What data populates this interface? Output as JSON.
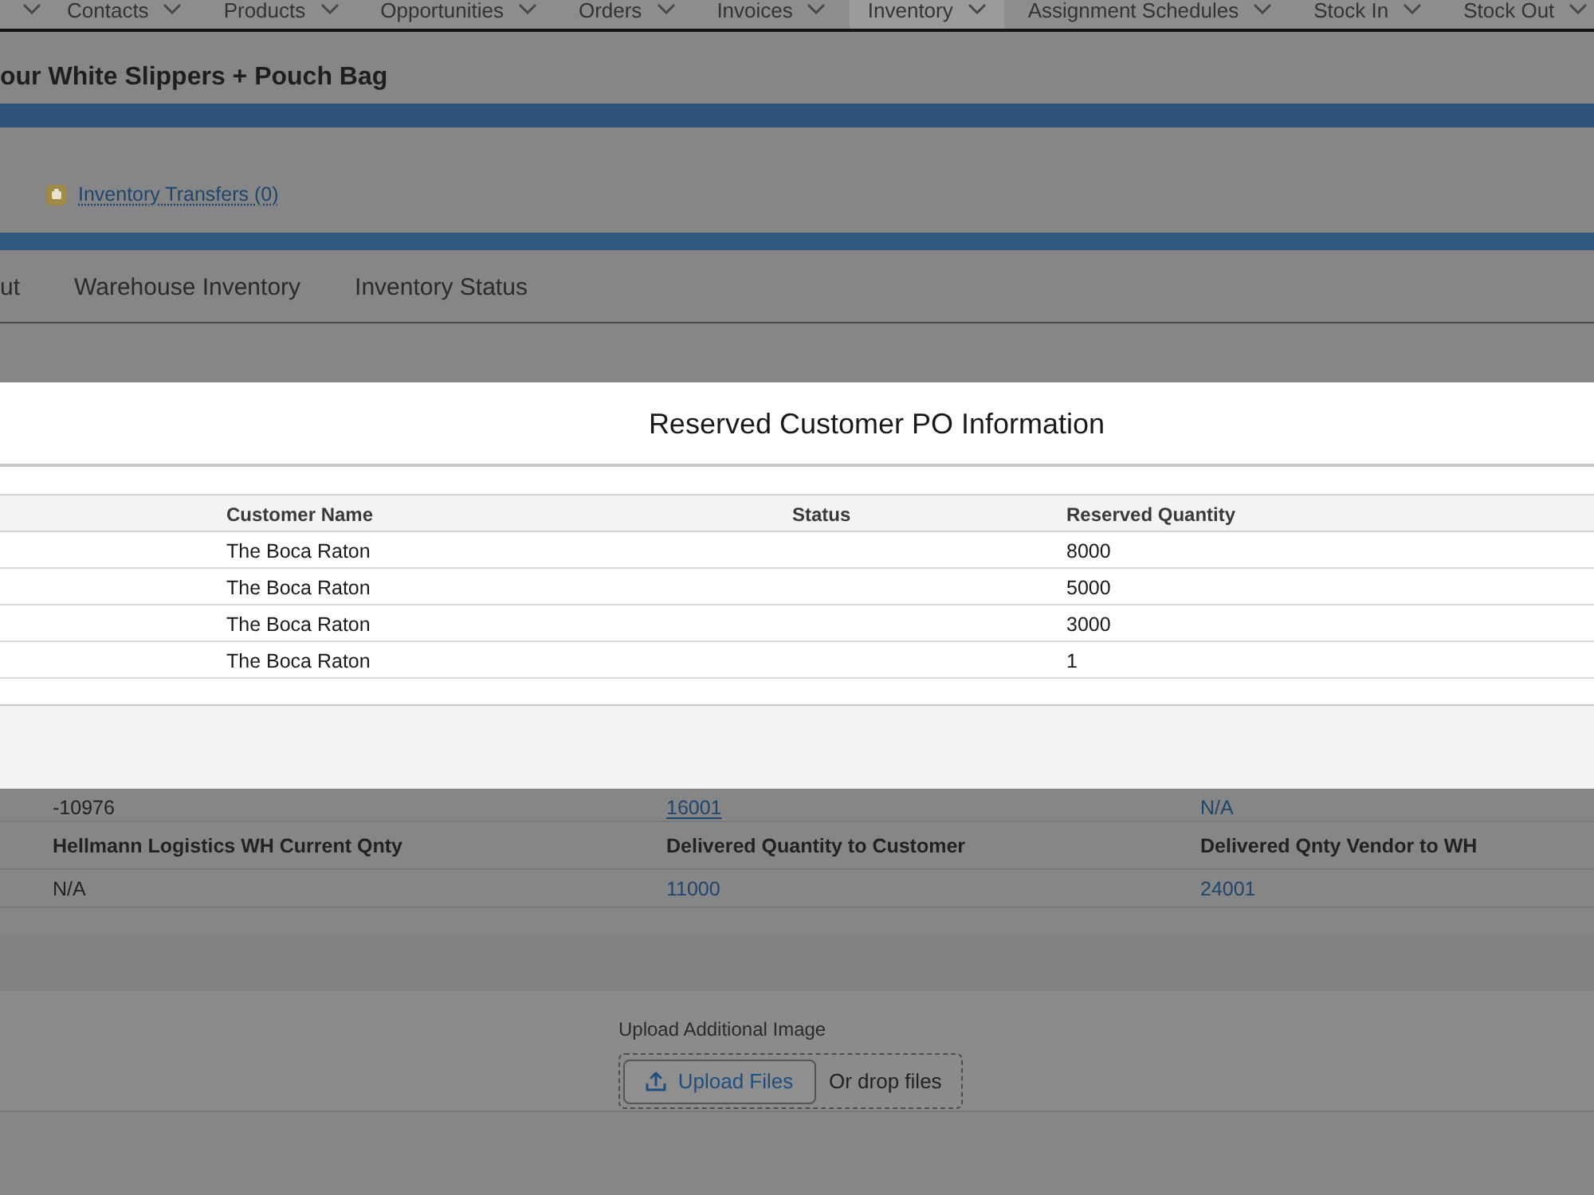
{
  "nav": {
    "items": [
      {
        "label": "Contacts",
        "selected": false
      },
      {
        "label": "Products",
        "selected": false
      },
      {
        "label": "Opportunities",
        "selected": false
      },
      {
        "label": "Orders",
        "selected": false
      },
      {
        "label": "Invoices",
        "selected": false
      },
      {
        "label": "Inventory",
        "selected": true
      },
      {
        "label": "Assignment Schedules",
        "selected": false
      },
      {
        "label": "Stock In",
        "selected": false
      },
      {
        "label": "Stock Out",
        "selected": false
      }
    ]
  },
  "record": {
    "title": "our White Slippers + Pouch Bag"
  },
  "related_lists": [
    {
      "label": "Inventory Transfers (0)"
    }
  ],
  "tabs": [
    {
      "label": "ut",
      "selected": false
    },
    {
      "label": "Warehouse Inventory",
      "selected": false
    },
    {
      "label": "Inventory Status",
      "selected": false
    }
  ],
  "modal": {
    "title": "Reserved Customer PO Information",
    "table": {
      "columns": [
        "Customer Name",
        "Status",
        "Reserved Quantity"
      ],
      "rows": [
        {
          "customer_name": "The Boca Raton",
          "reserved_quantity": "8000"
        },
        {
          "customer_name": "The Boca Raton",
          "reserved_quantity": "5000"
        },
        {
          "customer_name": "The Boca Raton",
          "reserved_quantity": "3000"
        },
        {
          "customer_name": "The Boca Raton",
          "reserved_quantity": "1"
        }
      ]
    }
  },
  "details": {
    "partial_row": [
      {
        "value": "-10976",
        "kind": "text"
      },
      {
        "value": "16001",
        "kind": "underlined_link"
      },
      {
        "value": "N/A",
        "kind": "link"
      }
    ],
    "fields": [
      {
        "label": "Hellmann Logistics WH Current Qnty",
        "value": "N/A",
        "kind": "text"
      },
      {
        "label": "Delivered Quantity to Customer",
        "value": "11000",
        "kind": "link"
      },
      {
        "label": "Delivered Qnty Vendor to WH",
        "value": "24001",
        "kind": "link"
      }
    ]
  },
  "upload": {
    "label": "Upload Additional Image",
    "button": "Upload Files",
    "drop_text": "Or drop files"
  }
}
